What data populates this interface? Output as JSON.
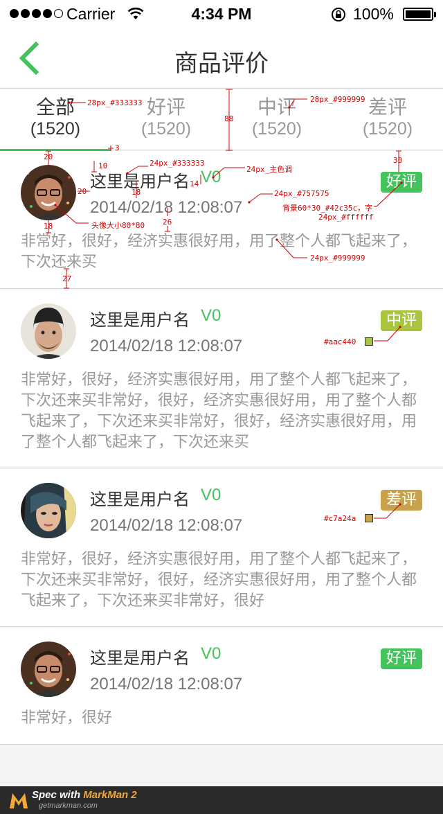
{
  "status_bar": {
    "carrier": "Carrier",
    "time": "4:34 PM",
    "battery": "100%"
  },
  "nav": {
    "title": "商品评价",
    "back_icon": "chevron-left-icon",
    "accent_color": "#42c35c"
  },
  "tabs": [
    {
      "label": "全部",
      "count": "(1520)",
      "active": true
    },
    {
      "label": "好评",
      "count": "(1520)",
      "active": false
    },
    {
      "label": "中评",
      "count": "(1520)",
      "active": false
    },
    {
      "label": "差评",
      "count": "(1520)",
      "active": false
    }
  ],
  "reviews": [
    {
      "username": "这里是用户名",
      "level": "V0",
      "date": "2014/02/18 12:08:07",
      "badge": "好评",
      "badge_color": "#42c35c",
      "comment": "非常好，很好，经济实惠很好用，用了整个人都飞起来了，下次还来买"
    },
    {
      "username": "这里是用户名",
      "level": "V0",
      "date": "2014/02/18 12:08:07",
      "badge": "中评",
      "badge_color": "#aac440",
      "comment": "非常好，很好，经济实惠很好用，用了整个人都飞起来了，下次还来买非常好，很好，经济实惠很好用，用了整个人都飞起来了，下次还来买非常好，很好，经济实惠很好用，用了整个人都飞起来了，下次还来买"
    },
    {
      "username": "这里是用户名",
      "level": "V0",
      "date": "2014/02/18 12:08:07",
      "badge": "差评",
      "badge_color": "#c7a24a",
      "comment": "非常好，很好，经济实惠很好用，用了整个人都飞起来了，下次还来买非常好，很好，经济实惠很好用，用了整个人都飞起来了，下次还来买非常好，很好"
    },
    {
      "username": "这里是用户名",
      "level": "V0",
      "date": "2014/02/18 12:08:07",
      "badge": "好评",
      "badge_color": "#42c35c",
      "comment": "非常好，很好"
    }
  ],
  "annotations": {
    "tab_active_text": "28px_#333333",
    "tab_inactive_text": "28px_#999999",
    "tab_height": "88",
    "underline_height": "3",
    "username_spec": "24px_#333333",
    "level_spec": "24px_主色调",
    "date_spec": "24px_#757575",
    "badge_spec_line1": "背景60*30_#42c35c，字",
    "badge_spec_line2": "24px_#ffffff",
    "comment_spec": "24px_#999999",
    "avatar_spec": "头像大小80*80",
    "gap_20a": "20",
    "gap_10": "10",
    "gap_14": "14",
    "gap_18a": "18",
    "gap_20b": "20",
    "gap_18b": "18",
    "gap_26": "26",
    "gap_30": "30",
    "gap_27": "27",
    "mid_color": "#aac440",
    "bad_color": "#c7a24a"
  },
  "footer": {
    "brand_prefix": "Spec with ",
    "brand_name": "MarkMan 2",
    "site": "getmarkman.com"
  }
}
